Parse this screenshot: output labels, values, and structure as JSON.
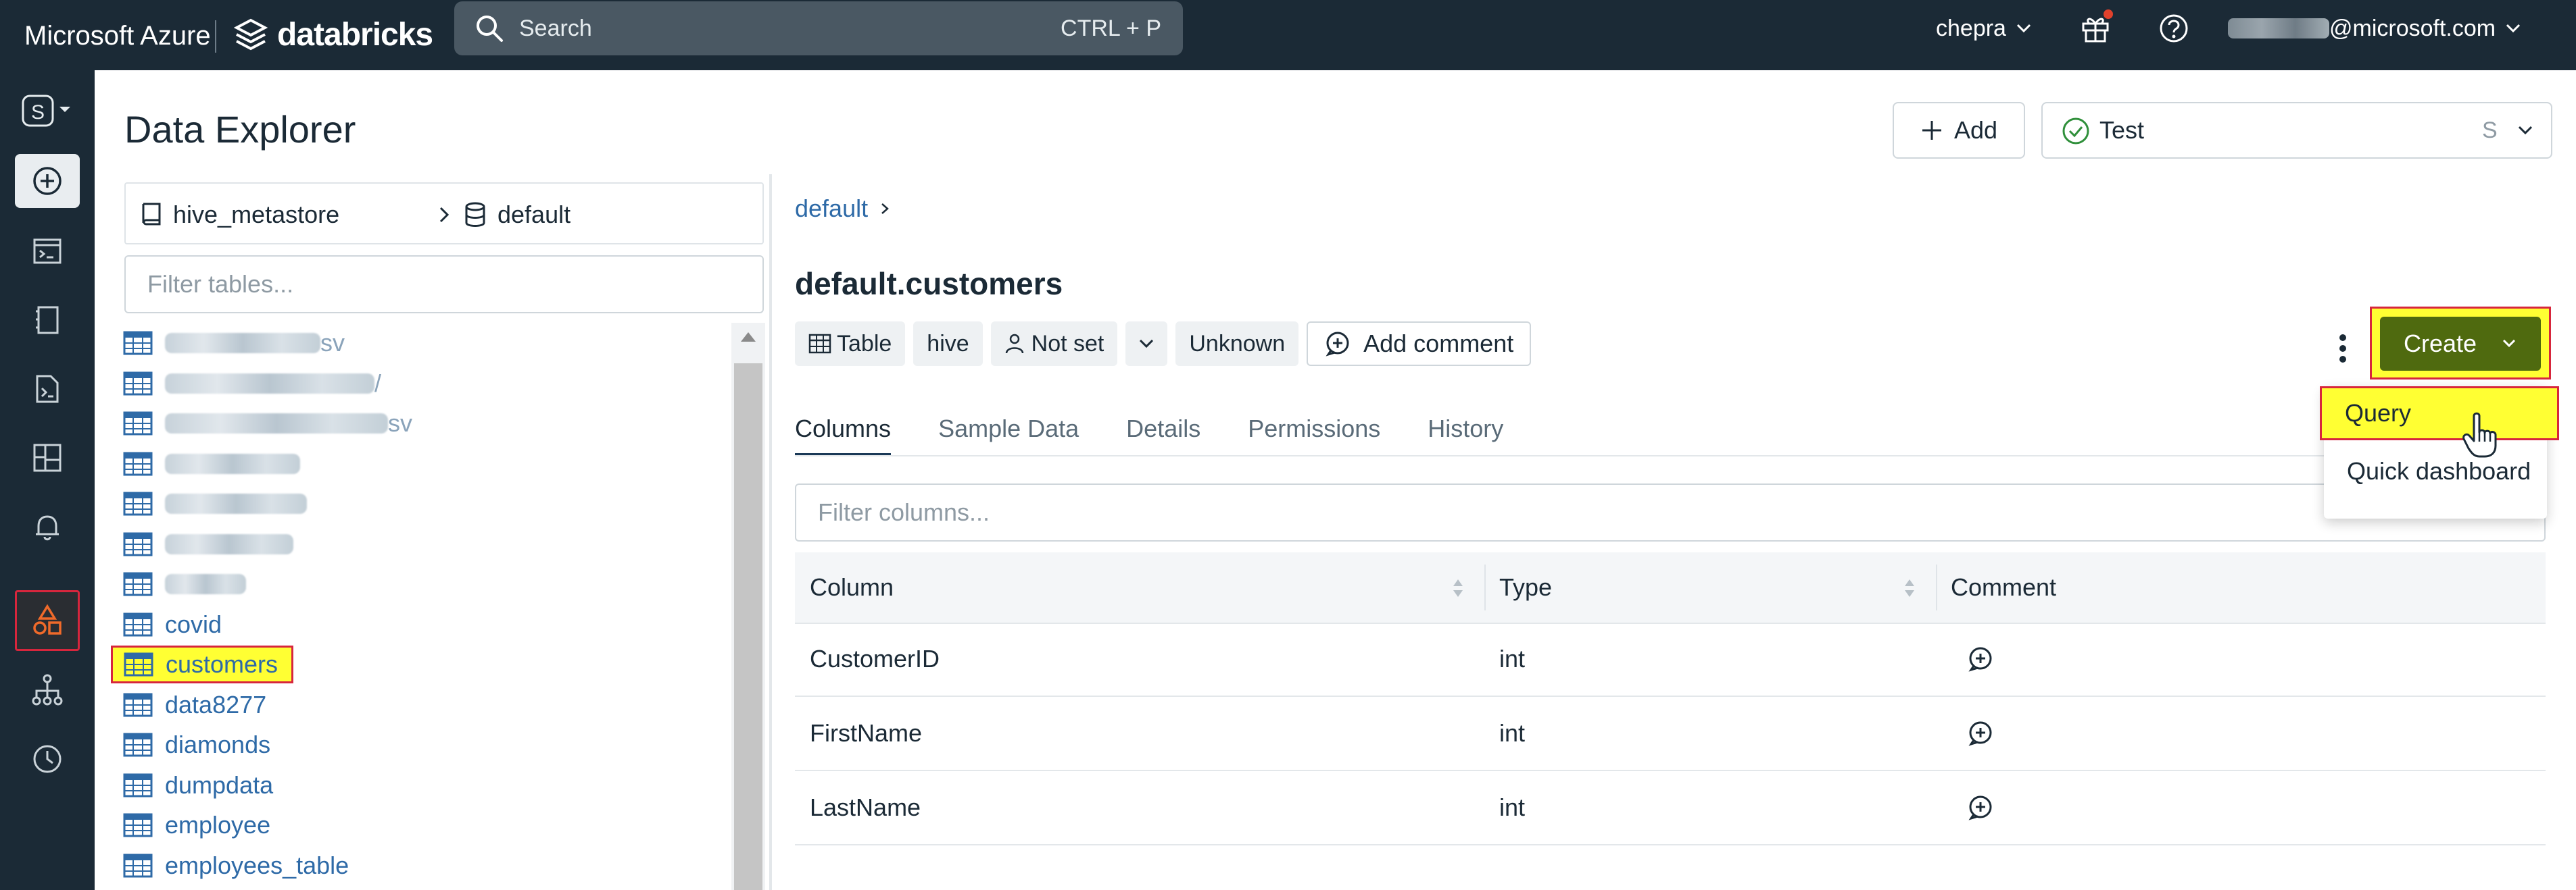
{
  "topbar": {
    "brand_ms": "Microsoft Azure",
    "brand_db": "databricks",
    "search_placeholder": "Search",
    "search_shortcut": "CTRL + P",
    "user": "chepra",
    "email_suffix": "@microsoft.com"
  },
  "sidebar": {
    "workspace_letter": "S",
    "items": [
      "new-icon",
      "sql-editor-icon",
      "queries-icon",
      "alerts-list-icon",
      "dashboards-icon",
      "alerts-icon",
      "data-icon",
      "workflows-icon",
      "history-icon"
    ]
  },
  "page": {
    "title": "Data Explorer",
    "add_label": "Add",
    "warehouse_name": "Test",
    "warehouse_size": "S"
  },
  "catalog": {
    "catalog": "hive_metastore",
    "schema": "default",
    "filter_placeholder": "Filter tables...",
    "tables": [
      {
        "name": "",
        "suffix": "sv",
        "blurred": true,
        "blur_w": 230
      },
      {
        "name": "",
        "suffix": "/",
        "blurred": true,
        "blur_w": 310
      },
      {
        "name": "",
        "suffix": "sv",
        "blurred": true,
        "blur_w": 330
      },
      {
        "name": "",
        "suffix": "",
        "blurred": true,
        "blur_w": 200
      },
      {
        "name": "",
        "suffix": "",
        "blurred": true,
        "blur_w": 210
      },
      {
        "name": "",
        "suffix": "",
        "blurred": true,
        "blur_w": 190
      },
      {
        "name": "",
        "suffix": "",
        "blurred": true,
        "blur_w": 120
      },
      {
        "name": "covid",
        "blurred": false
      },
      {
        "name": "customers",
        "blurred": false,
        "highlight": true
      },
      {
        "name": "data8277",
        "blurred": false
      },
      {
        "name": "diamonds",
        "blurred": false
      },
      {
        "name": "dumpdata",
        "blurred": false
      },
      {
        "name": "employee",
        "blurred": false
      },
      {
        "name": "employees_table",
        "blurred": false
      }
    ]
  },
  "detail": {
    "breadcrumb": "default",
    "title": "default.customers",
    "tags": {
      "type": "Table",
      "source": "hive",
      "owner": "Not set",
      "status": "Unknown"
    },
    "add_comment": "Add comment",
    "create_label": "Create",
    "menu": [
      "Query",
      "Quick dashboard"
    ],
    "tabs": [
      "Columns",
      "Sample Data",
      "Details",
      "Permissions",
      "History"
    ],
    "active_tab": "Columns",
    "filter_placeholder": "Filter columns...",
    "headers": [
      "Column",
      "Type",
      "Comment"
    ],
    "rows": [
      {
        "column": "CustomerID",
        "type": "int"
      },
      {
        "column": "FirstName",
        "type": "int"
      },
      {
        "column": "LastName",
        "type": "int"
      }
    ]
  },
  "colors": {
    "topbar": "#1b2a36",
    "link": "#2e6aa7",
    "create": "#4f6a0f",
    "highlight": "#ffff33",
    "highlight_border": "#d7263d",
    "data_icon": "#f06a2a"
  }
}
